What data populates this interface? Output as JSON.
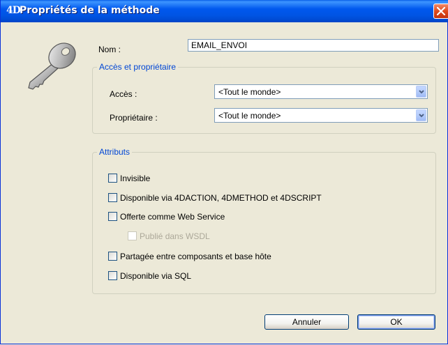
{
  "window": {
    "logo": "4D",
    "title": "Propriétés de la méthode"
  },
  "icons": {
    "close": "close-icon",
    "key": "key-icon",
    "dropdown": "chevron-down-icon"
  },
  "colors": {
    "titlebar": "#0054e3",
    "group_title": "#0046d5",
    "close_button": "#e04a1c"
  },
  "name_field": {
    "label": "Nom :",
    "value": "EMAIL_ENVOI"
  },
  "access_group": {
    "title": "Accès et propriétaire",
    "access_label": "Accès :",
    "access_value": "<Tout le monde>",
    "owner_label": "Propriétaire :",
    "owner_value": "<Tout le monde>"
  },
  "attributes": {
    "title": "Attributs",
    "items": [
      {
        "label": "Invisible",
        "checked": false,
        "enabled": true
      },
      {
        "label": "Disponible via 4DACTION, 4DMETHOD et 4DSCRIPT",
        "checked": false,
        "enabled": true
      },
      {
        "label": "Offerte comme Web Service",
        "checked": false,
        "enabled": true
      },
      {
        "label": "Publié dans WSDL",
        "checked": false,
        "enabled": false
      },
      {
        "label": "Partagée entre composants et base hôte",
        "checked": false,
        "enabled": true
      },
      {
        "label": "Disponible via SQL",
        "checked": false,
        "enabled": true
      }
    ]
  },
  "buttons": {
    "cancel": "Annuler",
    "ok": "OK"
  }
}
